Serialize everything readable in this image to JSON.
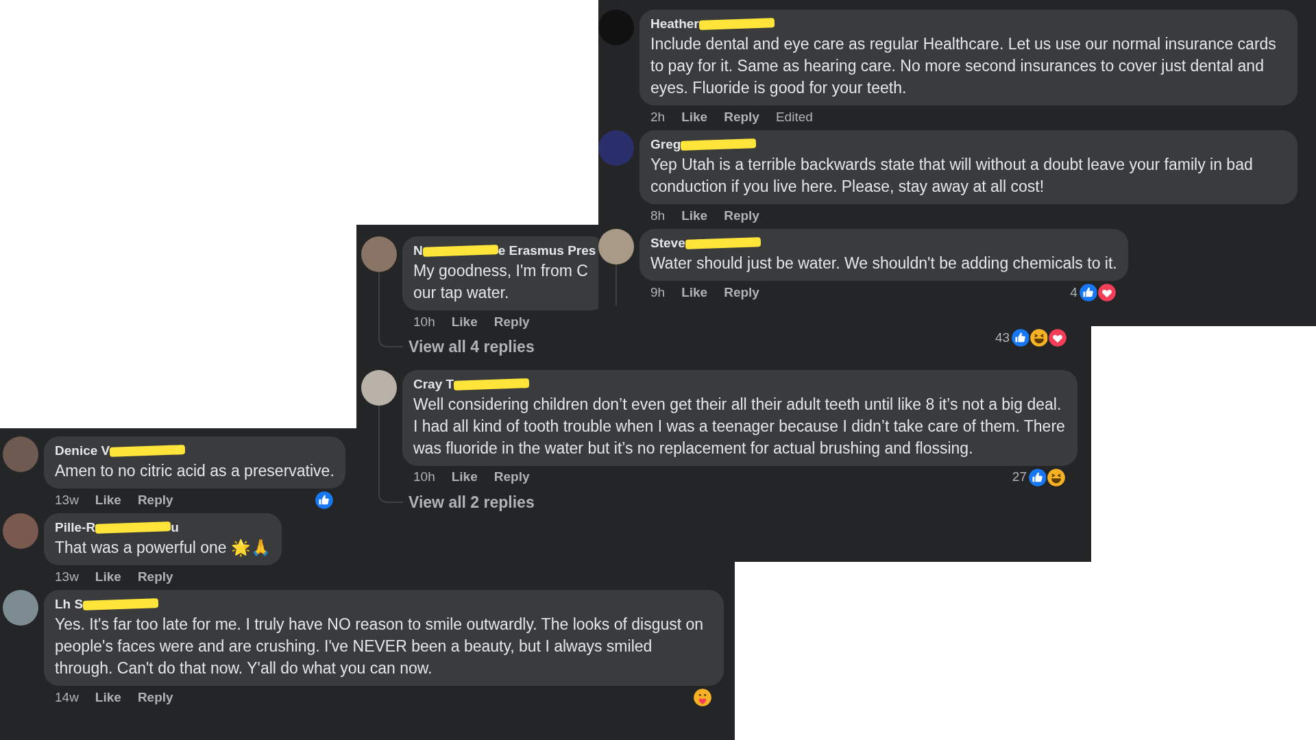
{
  "panels": [
    {
      "comments": [
        {
          "author_parts": [
            "Heather"
          ],
          "text": "Include dental and eye care as regular Healthcare. Let us use our normal insurance cards to pay for it. Same as hearing care. No more second insurances to cover just dental and eyes. Fluoride is good for your teeth.",
          "time": "2h",
          "actions": [
            "Like",
            "Reply"
          ],
          "edited": "Edited",
          "thread": false
        },
        {
          "author_parts": [
            "Greg"
          ],
          "text": "Yep Utah is a terrible backwards state that will without a doubt leave your family in bad conduction if you live here. Please, stay away at all cost!",
          "time": "8h",
          "actions": [
            "Like",
            "Reply"
          ],
          "thread": false
        },
        {
          "author_parts": [
            "Steve"
          ],
          "text": "Water should just be water. We shouldn't be adding chemicals to it.",
          "time": "9h",
          "actions": [
            "Like",
            "Reply"
          ],
          "reactions": {
            "count": "4",
            "icons": [
              {
                "kind": "like"
              },
              {
                "kind": "love"
              }
            ]
          },
          "thread": true
        }
      ]
    },
    {
      "comments": [
        {
          "author_parts": [
            "N",
            "e Erasmus Pres"
          ],
          "text": "My goodness, I'm from C\nour tap water.",
          "time": "10h",
          "actions": [
            "Like",
            "Reply"
          ],
          "thread": true,
          "reply_link": "View all 4 replies"
        },
        {
          "author_parts": [
            "Cray T"
          ],
          "text": "Well considering children don’t even get their all their adult teeth until like 8 it’s not a big deal. I had all kind of tooth trouble when I was a teenager because I didn’t take care of them. There was fluoride in the water but it’s no replacement for actual brushing and flossing.",
          "time": "10h",
          "actions": [
            "Like",
            "Reply"
          ],
          "reactions": {
            "count": "27",
            "icons": [
              {
                "kind": "like"
              },
              {
                "kind": "haha"
              }
            ]
          },
          "thread": true,
          "reply_link": "View all 2 replies"
        }
      ],
      "stray_reactions": {
        "count": "43",
        "icons": [
          {
            "kind": "like"
          },
          {
            "kind": "haha"
          },
          {
            "kind": "love"
          }
        ]
      }
    },
    {
      "comments": [
        {
          "author_parts": [
            "Denice V"
          ],
          "text": "Amen to no citric acid as a preservative.",
          "time": "13w",
          "actions": [
            "Like",
            "Reply"
          ],
          "reactions": {
            "icons": [
              {
                "kind": "like"
              }
            ]
          },
          "thread": false
        },
        {
          "author_parts": [
            "Pille-R",
            "u"
          ],
          "text": "That was a powerful one 🌟🙏",
          "time": "13w",
          "actions": [
            "Like",
            "Reply"
          ],
          "thread": false
        },
        {
          "author_parts": [
            "Lh S"
          ],
          "text": "Yes. It's far too late for me. I truly have NO reason to smile outwardly. The looks of disgust on people's faces were and are crushing. I've NEVER been a beauty, but I always smiled through. Can't do that now. Y'all do what you can now.",
          "time": "14w",
          "actions": [
            "Like",
            "Reply"
          ],
          "reactions": {
            "icons": [
              {
                "kind": "care"
              }
            ]
          },
          "thread": false
        }
      ]
    }
  ]
}
